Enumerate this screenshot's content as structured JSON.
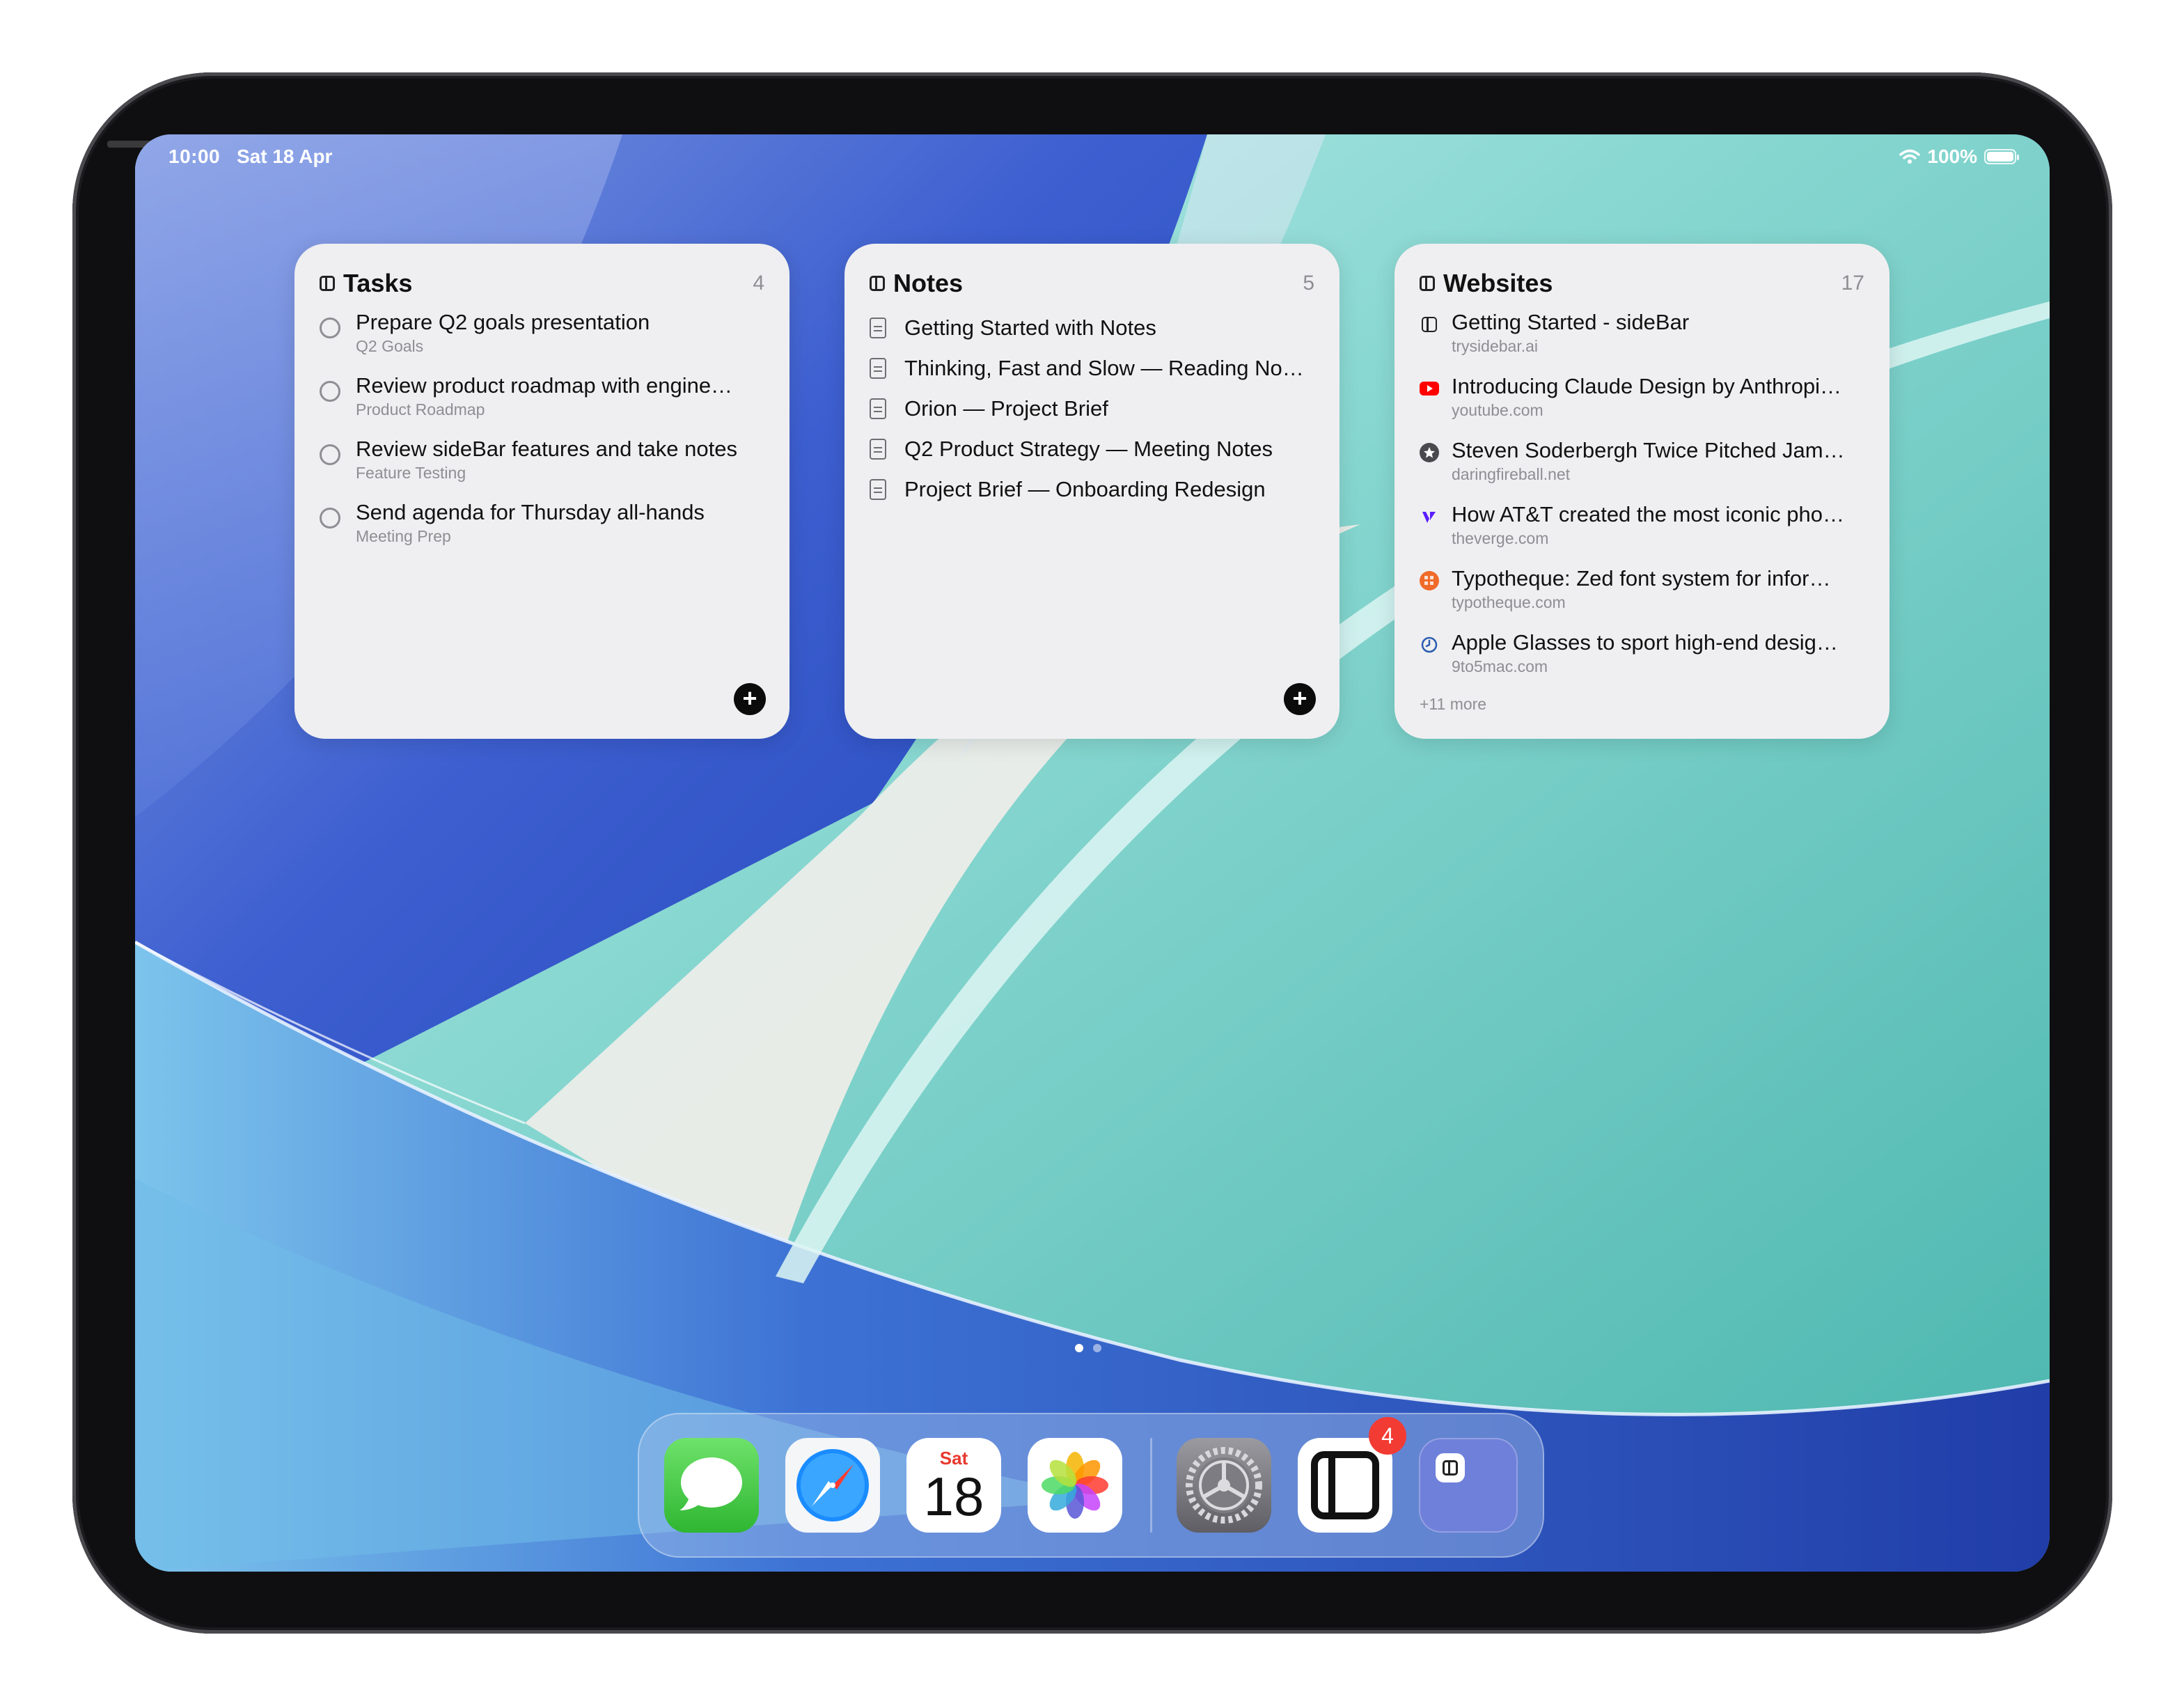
{
  "status_bar": {
    "time": "10:00",
    "date": "Sat 18 Apr",
    "battery": "100%"
  },
  "widgets": {
    "tasks": {
      "title": "Tasks",
      "count": "4",
      "items": [
        {
          "title": "Prepare Q2 goals presentation",
          "subtitle": "Q2 Goals"
        },
        {
          "title": "Review product roadmap with engine…",
          "subtitle": "Product Roadmap"
        },
        {
          "title": "Review sideBar features and take notes",
          "subtitle": "Feature Testing"
        },
        {
          "title": "Send agenda for Thursday all-hands",
          "subtitle": "Meeting Prep"
        }
      ],
      "add_label": "+"
    },
    "notes": {
      "title": "Notes",
      "count": "5",
      "items": [
        {
          "title": "Getting Started with Notes"
        },
        {
          "title": "Thinking, Fast and Slow — Reading No…"
        },
        {
          "title": "Orion — Project Brief"
        },
        {
          "title": "Q2 Product Strategy — Meeting Notes"
        },
        {
          "title": "Project Brief — Onboarding Redesign"
        }
      ],
      "add_label": "+"
    },
    "websites": {
      "title": "Websites",
      "count": "17",
      "items": [
        {
          "title": "Getting Started - sideBar",
          "domain": "trysidebar.ai",
          "icon": "sidebar-icon"
        },
        {
          "title": "Introducing Claude Design by Anthropi…",
          "domain": "youtube.com",
          "icon": "youtube-icon"
        },
        {
          "title": "Steven Soderbergh Twice Pitched Jam…",
          "domain": "daringfireball.net",
          "icon": "star-icon"
        },
        {
          "title": "How AT&T created the most iconic pho…",
          "domain": "theverge.com",
          "icon": "verge-icon"
        },
        {
          "title": "Typotheque: Zed font system for infor…",
          "domain": "typotheque.com",
          "icon": "typotheque-icon"
        },
        {
          "title": "Apple Glasses to sport high-end desig…",
          "domain": "9to5mac.com",
          "icon": "clock-icon"
        }
      ],
      "more": "+11 more"
    }
  },
  "dock": {
    "apps": [
      {
        "name": "Messages",
        "icon": "messages-icon"
      },
      {
        "name": "Safari",
        "icon": "safari-icon"
      },
      {
        "name": "Calendar",
        "icon": "calendar-icon",
        "day_label": "Sat",
        "day_number": "18"
      },
      {
        "name": "Photos",
        "icon": "photos-icon"
      },
      {
        "name": "Settings",
        "icon": "settings-icon"
      },
      {
        "name": "sideBar",
        "icon": "sidebar-app-icon",
        "badge": "4"
      },
      {
        "name": "sideBar folder",
        "icon": "sidebar-folder-icon"
      }
    ]
  },
  "page_dots": {
    "count": 2,
    "active": 0
  },
  "colors": {
    "accent_blue": "#3b5bcc",
    "teal": "#5ec8c0",
    "badge_red": "#f23b33"
  }
}
